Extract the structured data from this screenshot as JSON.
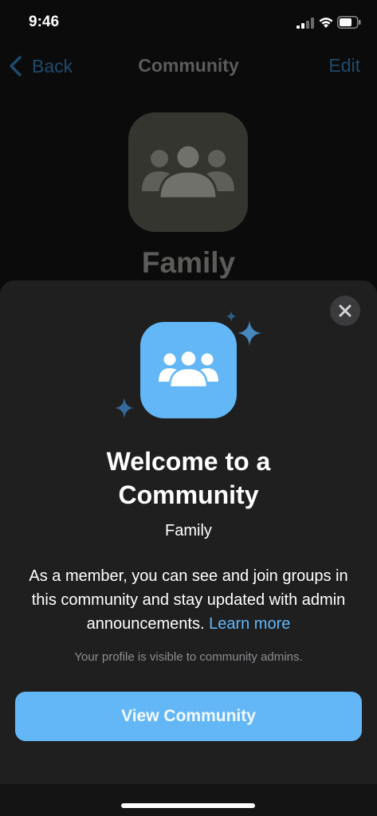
{
  "status_bar": {
    "time": "9:46"
  },
  "nav": {
    "back_label": "Back",
    "title": "Community",
    "edit_label": "Edit"
  },
  "background": {
    "community_name": "Family"
  },
  "sheet": {
    "title_line1": "Welcome to a",
    "title_line2": "Community",
    "community_name": "Family",
    "description": "As a member, you can see and join groups in this community and stay updated with admin announcements.",
    "learn_more": "Learn more",
    "privacy_note": "Your profile is visible to community admins.",
    "cta_label": "View Community"
  },
  "colors": {
    "accent": "#63b7f7",
    "sheet_bg": "#1f1f20",
    "nav_link": "#1e4b6d"
  }
}
